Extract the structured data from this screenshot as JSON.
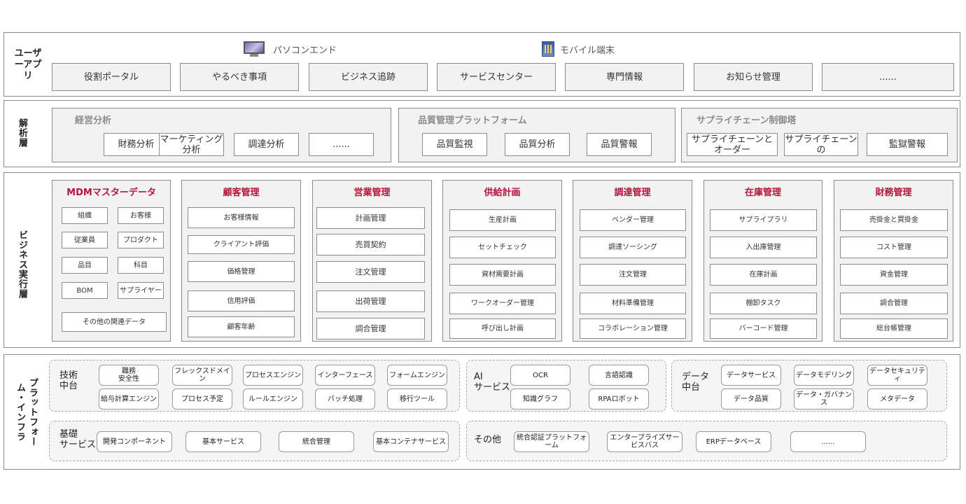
{
  "user_layer": {
    "label": "ユーザーアプリ",
    "devices": [
      {
        "label": "パソコンエンド",
        "icon": "desktop-computer-icon"
      },
      {
        "label": "モバイル端末",
        "icon": "mobile-device-icon"
      }
    ],
    "apps": [
      "役割ポータル",
      "やるべき事項",
      "ビジネス追跡",
      "サービスセンター",
      "専門情報",
      "お知らせ管理",
      "......"
    ]
  },
  "analysis_layer": {
    "label": "解析層",
    "groups": [
      {
        "title": "経営分析",
        "items": [
          "財務分析",
          "マーケティング分析",
          "調達分析",
          "......"
        ]
      },
      {
        "title": "品質管理プラットフォーム",
        "items": [
          "品質監視",
          "品質分析",
          "品質警報"
        ]
      },
      {
        "title": "サプライチェーン制御塔",
        "items": [
          "サプライチェーンとオーダー",
          "サプライチェーンの",
          "監獄警報"
        ]
      }
    ]
  },
  "business_layer": {
    "label": "ビジネス実行層",
    "mdm": {
      "title": "MDMマスターデータ",
      "items": [
        "組織",
        "お客様",
        "従業員",
        "プロダクト",
        "品目",
        "科目",
        "BOM",
        "サプライヤー"
      ],
      "footer": "その他の関連データ"
    },
    "columns": [
      {
        "title": "顧客管理",
        "items": [
          "お客様情報",
          "クライアント評価",
          "価格管理",
          "信用評価",
          "顧客年齢"
        ]
      },
      {
        "title": "営業管理",
        "items": [
          "計画管理",
          "売買契約",
          "注文管理",
          "出荷管理",
          "調合管理"
        ]
      },
      {
        "title": "供給計画",
        "items": [
          "生産計画",
          "セットチェック",
          "資材需要計画",
          "ワークオーダー管理",
          "呼び出し計画"
        ]
      },
      {
        "title": "調達管理",
        "items": [
          "ベンダー管理",
          "調達ソーシング",
          "注文管理",
          "材料準備管理",
          "コラボレーション管理"
        ]
      },
      {
        "title": "在庫管理",
        "items": [
          "サプライプラリ",
          "入出庫管理",
          "在庫計画",
          "棚卸タスク",
          "バーコード管理"
        ]
      },
      {
        "title": "財務管理",
        "items": [
          "売掛金と買掛金",
          "コスト管理",
          "資金管理",
          "調合管理",
          "総台帳管理"
        ]
      }
    ]
  },
  "platform_layer": {
    "label": "プラットフォーム・インフラ",
    "tech": {
      "label": "技術\n中台",
      "items": [
        "職務\n安全性",
        "フレックスドメイン",
        "プロセスエンジン",
        "インターフェース",
        "フォームエンジン",
        "給与計算エンジン",
        "プロセス予定",
        "ルールエンジン",
        "バッチ処理",
        "移行ツール"
      ]
    },
    "ai": {
      "label": "AI\nサービス",
      "items": [
        "OCR",
        "言語認識",
        "知識グラフ",
        "RPAロボット"
      ]
    },
    "data": {
      "label": "データ\n中台",
      "items": [
        "データサービス",
        "データモデリング",
        "データセキュリティ",
        "データ品質",
        "データ・ガバナンス",
        "メタデータ"
      ]
    },
    "base": {
      "label": "基礎\nサービス",
      "items": [
        "開発コンポーネント",
        "基本サービス",
        "統合管理",
        "基本コンテナサービス"
      ]
    },
    "other": {
      "label": "その他",
      "items": [
        "統合認証プラットフォーム",
        "エンタープライズサービスバス",
        "ERPデータベース",
        "......"
      ]
    }
  }
}
